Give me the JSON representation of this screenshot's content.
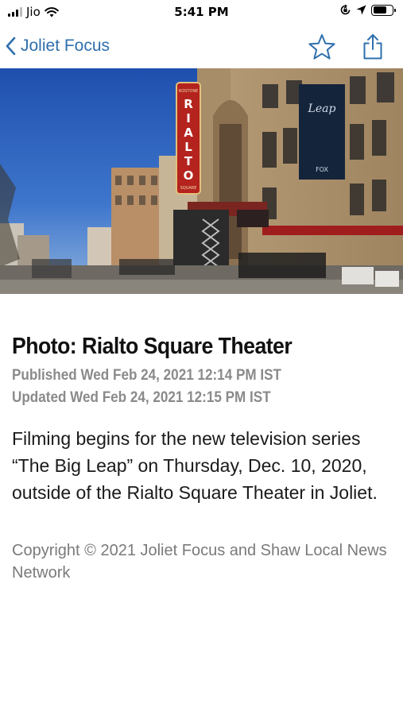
{
  "status_bar": {
    "carrier": "Jio",
    "time": "5:41 PM"
  },
  "nav": {
    "back_label": "Joliet Focus",
    "back_icon": "chevron-left-icon",
    "bookmark_icon": "star-icon",
    "share_icon": "share-icon",
    "accent_color": "#2f6fad"
  },
  "hero": {
    "marquee_text": "RIALTO"
  },
  "article": {
    "title": "Photo: Rialto Square Theater",
    "published": "Published Wed Feb 24, 2021 12:14 PM IST",
    "updated": "Updated Wed Feb 24, 2021 12:15 PM IST",
    "body": "Filming begins for the new television series “The Big Leap” on Thursday, Dec. 10, 2020, outside of the Rialto Square Theater in Joliet.",
    "copyright": "Copyright © 2021 Joliet Focus and Shaw Local News Network"
  }
}
